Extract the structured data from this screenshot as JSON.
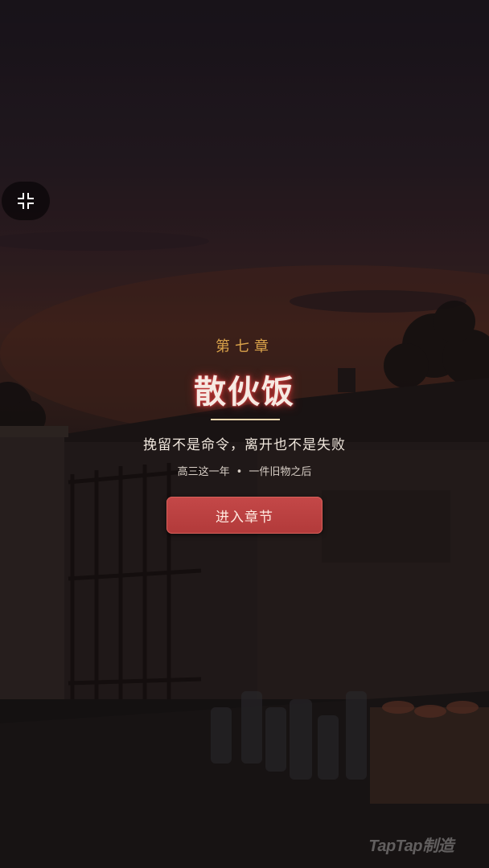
{
  "chapter": {
    "number_label": "第七章",
    "title": "散伙饭",
    "subtitle": "挽留不是命令，离开也不是失败",
    "meta_left": "高三这一年",
    "meta_separator": "•",
    "meta_right": "一件旧物之后"
  },
  "actions": {
    "enter_label": "进入章节"
  },
  "watermark": {
    "text": "TapTap制造"
  },
  "colors": {
    "chapter_label": "#d9a24a",
    "title_glow": "#c23a3a",
    "button": "#b8403f"
  },
  "icons": {
    "exit_fullscreen": "exit-fullscreen-icon"
  }
}
